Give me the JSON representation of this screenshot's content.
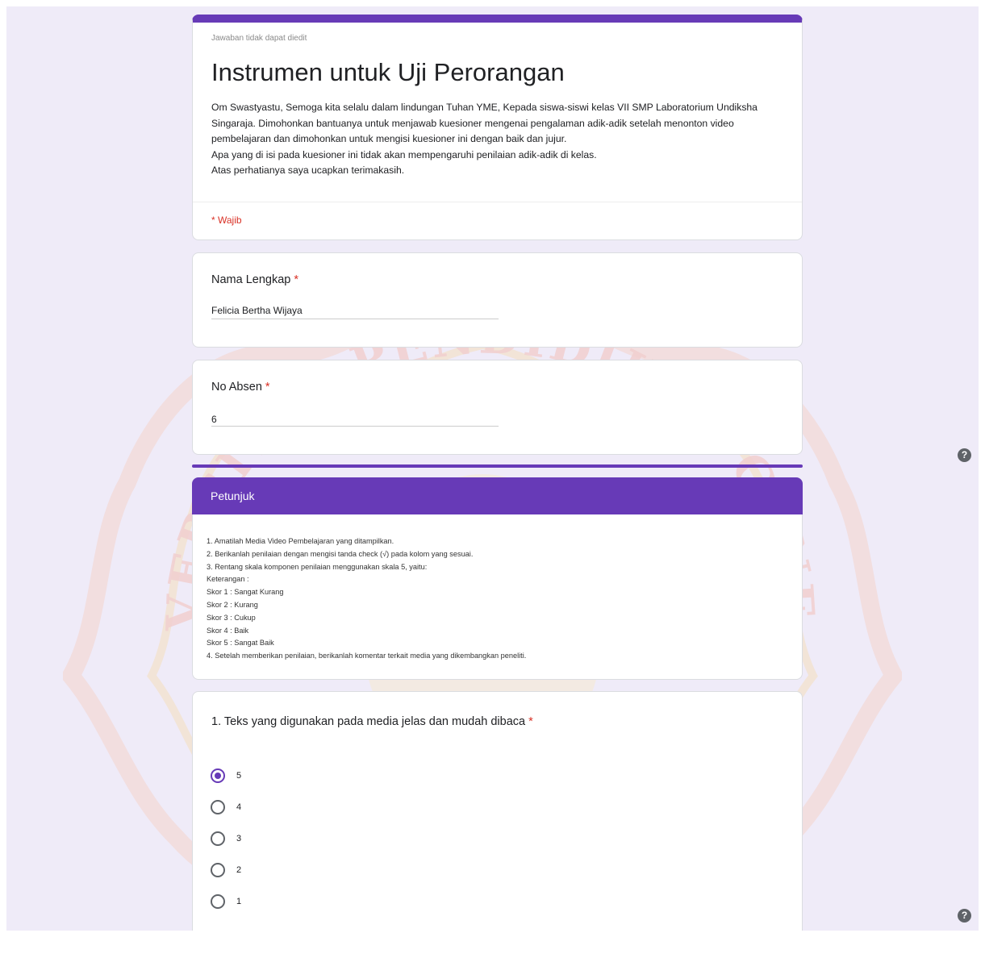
{
  "header": {
    "uneditable_note": "Jawaban tidak dapat diedit",
    "title": "Instrumen untuk Uji Perorangan",
    "description": [
      "Om Swastyastu, Semoga kita selalu dalam lindungan Tuhan YME, Kepada siswa-siswi kelas VII SMP Laboratorium Undiksha Singaraja. Dimohonkan bantuanya untuk menjawab kuesioner mengenai pengalaman adik-adik setelah menonton video pembelajaran dan dimohonkan untuk mengisi kuesioner ini dengan baik dan jujur.",
      "Apa yang di isi pada kuesioner ini tidak akan mempengaruhi penilaian adik-adik di kelas.",
      "Atas perhatianya saya ucapkan terimakasih."
    ],
    "required_note": "* Wajib"
  },
  "questions": {
    "name": {
      "label": "Nama Lengkap",
      "required": "*",
      "value": "Felicia Bertha Wijaya"
    },
    "absen": {
      "label": "No Absen",
      "required": "*",
      "value": "6"
    }
  },
  "section": {
    "title": "Petunjuk",
    "lines": [
      "1. Amatilah Media Video Pembelajaran yang ditampilkan.",
      "2. Berikanlah penilaian dengan mengisi tanda check (√) pada kolom yang sesuai.",
      "3. Rentang skala komponen penilaian menggunakan skala 5, yaitu:",
      "Keterangan :",
      "Skor 1 : Sangat Kurang",
      "Skor 2 : Kurang",
      "Skor 3 : Cukup",
      "Skor 4 : Baik",
      "Skor 5 : Sangat Baik",
      "4. Setelah memberikan penilaian, berikanlah komentar terkait media yang dikembangkan peneliti."
    ]
  },
  "radio_question": {
    "label": "1. Teks yang digunakan pada media jelas dan mudah dibaca",
    "required": "*",
    "options": [
      "5",
      "4",
      "3",
      "2",
      "1"
    ],
    "selected": "5"
  },
  "watermark": {
    "top_text": "UNIVERSITAS PENDIDIKAN GANESHA",
    "bottom_text": "UNDIKSHA"
  },
  "colors": {
    "accent": "#673ab7",
    "required": "#d93025",
    "background": "#efebf8"
  },
  "icons": {
    "help": "help-circle-icon"
  }
}
